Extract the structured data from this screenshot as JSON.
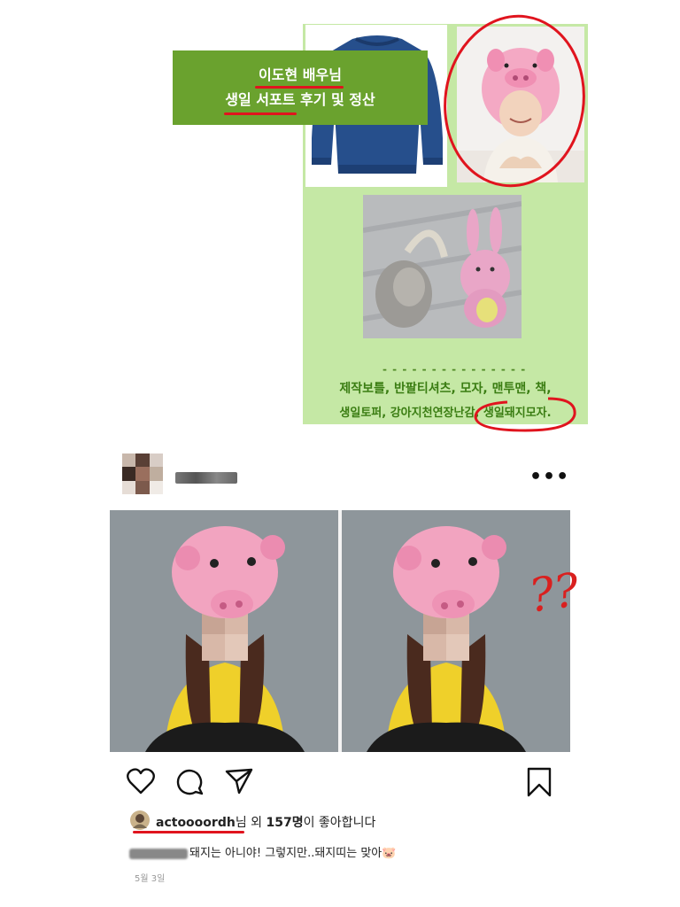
{
  "poster": {
    "title_line1": "이도현 배우님",
    "title_line2": "생일 서포트 후기 및 정산",
    "dashes": "- - - - - - - - - - - - - - -",
    "items_line1": "제작보틀, 반팔티셔츠, 모자, 맨투맨, 책,",
    "items_line2": "생일토퍼, 강아지천연장난감, 생일돼지모자."
  },
  "post": {
    "more_icon": "more-horizontal-icon",
    "annotation": "??",
    "actions": [
      "heart-icon",
      "comment-icon",
      "share-icon",
      "bookmark-icon"
    ],
    "liked_by_user": "actoooordh",
    "likes_prefix": "님 외 ",
    "likes_count": "157명",
    "likes_suffix": "이 좋아합니다",
    "comment_text": "돼지는 아니야! 그렇지만..돼지띠는 맞아",
    "comment_emoji": "🐷",
    "date": "5월 3일"
  },
  "colors": {
    "poster_bg": "#c5e8a5",
    "title_bg": "#6aa22e",
    "annotation_red": "#e0141e",
    "poster_text_green": "#3a7d12"
  }
}
